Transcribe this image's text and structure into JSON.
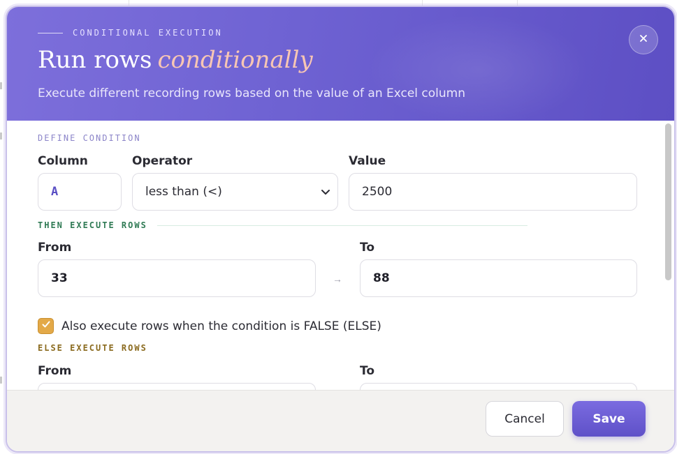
{
  "header": {
    "kicker": "CONDITIONAL EXECUTION",
    "title_main": "Run rows",
    "title_accent": "conditionally",
    "subtitle": "Execute different recording rows based on the value of an Excel column",
    "close_icon": "close-icon"
  },
  "condition": {
    "section_label": "DEFINE CONDITION",
    "column_label": "Column",
    "column_value": "A",
    "operator_label": "Operator",
    "operator_value": "less than (<)",
    "value_label": "Value",
    "value_value": "2500"
  },
  "then": {
    "section_label": "THEN EXECUTE ROWS",
    "from_label": "From",
    "from_value": "33",
    "to_label": "To",
    "to_value": "88",
    "arrow": "→"
  },
  "else_toggle": {
    "label": "Also execute rows when the condition is FALSE (ELSE)",
    "checked": true
  },
  "else": {
    "section_label": "ELSE EXECUTE ROWS",
    "from_label": "From",
    "to_label": "To"
  },
  "footer": {
    "cancel_label": "Cancel",
    "save_label": "Save"
  },
  "colors": {
    "header_gradient_start": "#7d6fdb",
    "header_gradient_end": "#5d4fc4",
    "accent_text": "#f8c6b4",
    "checkbox": "#e3a948",
    "then_label": "#2f7a54",
    "else_label": "#8a6a1e"
  }
}
